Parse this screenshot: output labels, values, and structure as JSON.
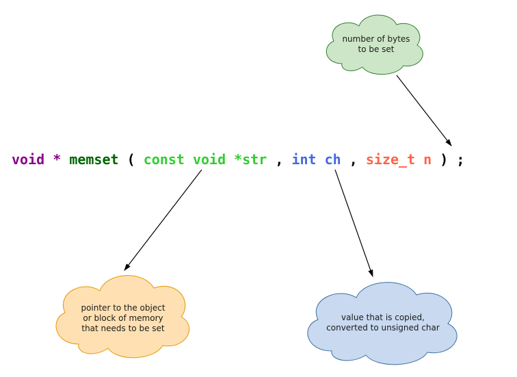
{
  "code": {
    "void": "void",
    "star": "*",
    "func": "memset",
    "open": "(",
    "space": " ",
    "arg1": "const void *str",
    "comma1": ",",
    "arg2": "int ch",
    "comma2": ",",
    "arg3": "size_t n",
    "close": ")",
    "semi": ";"
  },
  "annotations": {
    "bytes": {
      "text": "number of bytes\nto be set",
      "fill": "#cde6c7",
      "stroke": "#2e7d32"
    },
    "pointer": {
      "text": "pointer to the object\nor block of memory\nthat needs to be set",
      "fill": "#ffe0b2",
      "stroke": "#e69500"
    },
    "value": {
      "text": "value that is copied,\nconverted to unsigned char",
      "fill": "#c8d9f0",
      "stroke": "#3b6fa0"
    }
  }
}
